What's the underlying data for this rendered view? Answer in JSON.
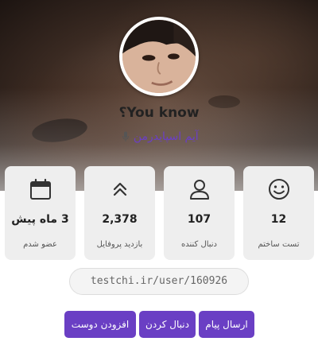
{
  "profile": {
    "username": "؟You know",
    "role": "آیم اسپایدرمن",
    "profile_url": "testchi.ir/user/160926"
  },
  "stats": [
    {
      "icon": "smiley-icon",
      "value": "12",
      "label": "تست ساختم"
    },
    {
      "icon": "user-icon",
      "value": "107",
      "label": "دنبال کننده"
    },
    {
      "icon": "double-chevron-up-icon",
      "value": "2,378",
      "label": "بازدید پروفایل"
    },
    {
      "icon": "calendar-icon",
      "value": "3 ماه پیش",
      "label": "عضو شدم"
    }
  ],
  "actions": {
    "send_message": "ارسال پیام",
    "follow": "دنبال کردن",
    "add_friend": "افزودن دوست"
  },
  "colors": {
    "accent": "#6a3fc4",
    "card_bg": "#eeeeee",
    "role_text": "#6b3fc5"
  }
}
